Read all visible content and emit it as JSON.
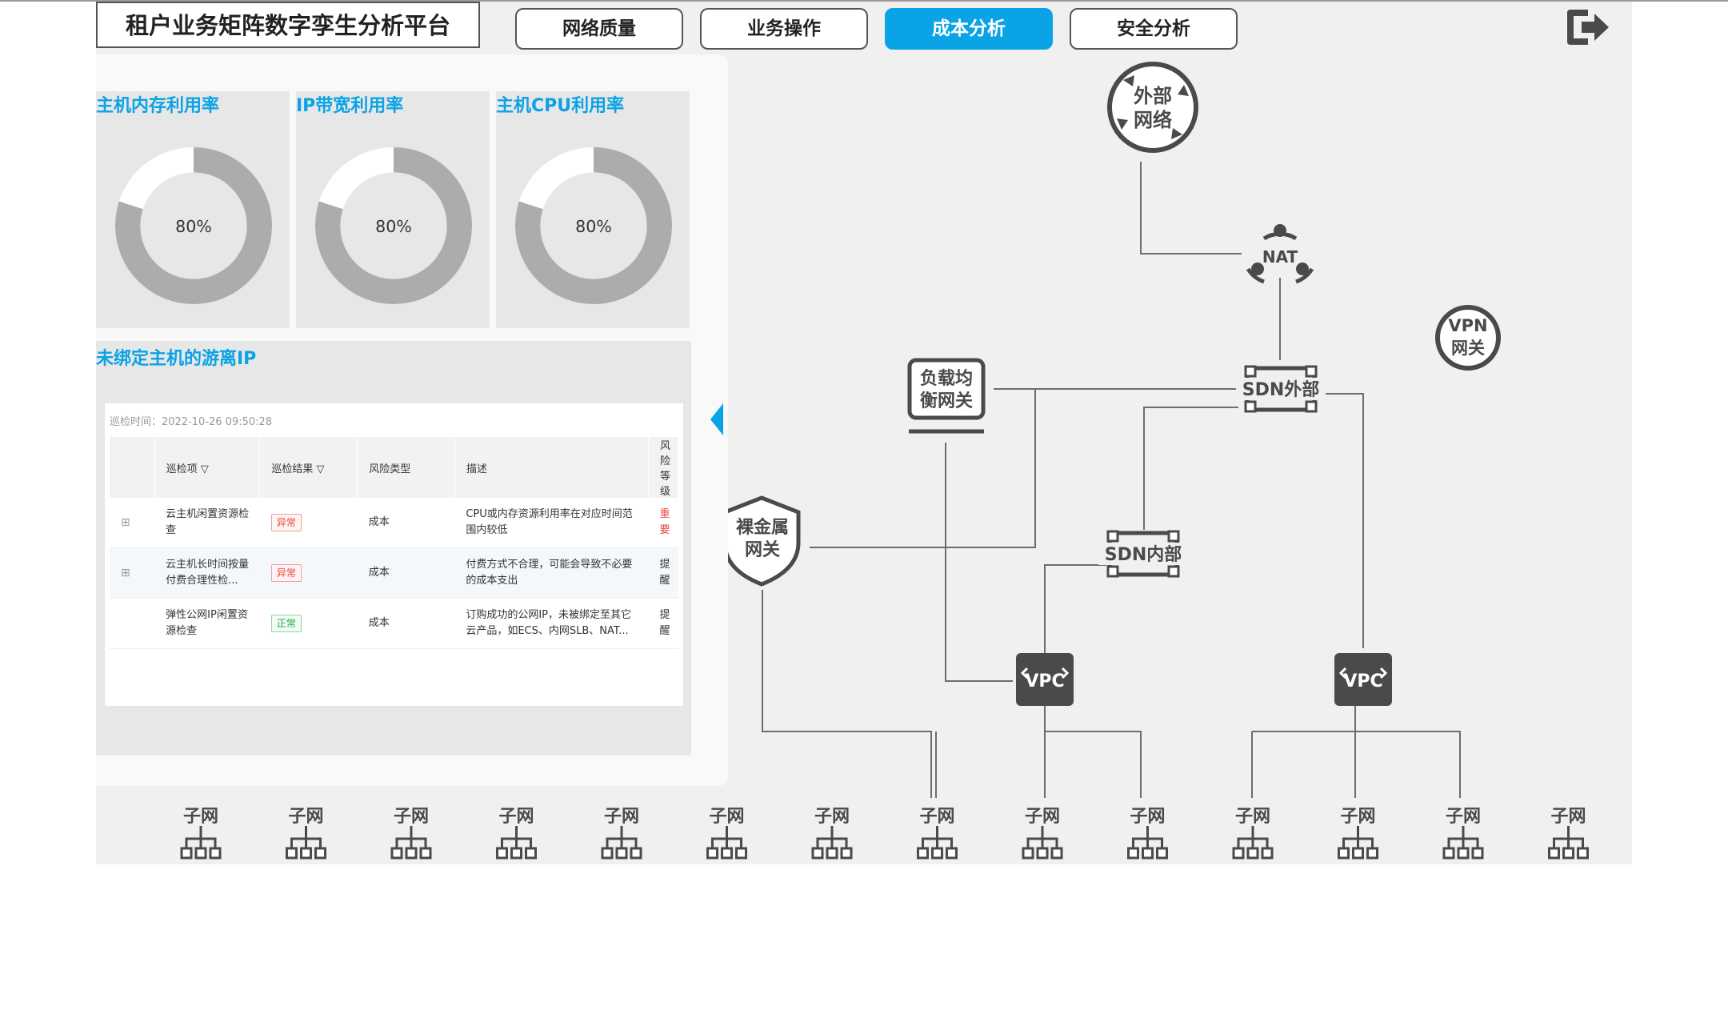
{
  "header": {
    "title": "租户业务矩阵数字孪生分析平台",
    "tabs": [
      {
        "label": "网络质量",
        "active": false
      },
      {
        "label": "业务操作",
        "active": false
      },
      {
        "label": "成本分析",
        "active": true
      },
      {
        "label": "安全分析",
        "active": false
      }
    ],
    "logout_icon": "logout-icon"
  },
  "colors": {
    "accent": "#0aa3e6",
    "error": "#e8453c",
    "ok": "#22a845",
    "node": "#4a4a4a"
  },
  "gauges": [
    {
      "title": "主机内存利用率",
      "value_label": "80%",
      "value": 0.8
    },
    {
      "title": "IP带宽利用率",
      "value_label": "80%",
      "value": 0.8
    },
    {
      "title": "主机CPU利用率",
      "value_label": "80%",
      "value": 0.8
    }
  ],
  "floating_ip": {
    "title": "未绑定主机的游离IP",
    "inspect_time": "巡检时间：2022-10-26 09:50:28",
    "columns": [
      "巡检项",
      "巡检结果",
      "风险类型",
      "描述",
      "风险等级"
    ],
    "rows": [
      {
        "item": "云主机闲置资源检查",
        "result": "异常",
        "result_type": "err",
        "risk_type": "成本",
        "desc": "CPU或内存资源利用率在对应时间范围内较低",
        "level": "重要",
        "level_red": true,
        "expandable": true
      },
      {
        "item": "云主机长时间按量付费合理性检...",
        "result": "异常",
        "result_type": "err",
        "risk_type": "成本",
        "desc": "付费方式不合理，可能会导致不必要的成本支出",
        "level": "提醒",
        "level_red": false,
        "expandable": true
      },
      {
        "item": "弹性公网IP闲置资源检查",
        "result": "正常",
        "result_type": "ok",
        "risk_type": "成本",
        "desc": "订购成功的公网IP，未被绑定至其它云产品，如ECS、内网SLB、NAT...",
        "level": "提醒",
        "level_red": false,
        "expandable": false
      }
    ]
  },
  "topology": {
    "external": [
      "外部",
      "网络"
    ],
    "nat": "NAT",
    "vpn": [
      "VPN",
      "网关"
    ],
    "sdn_ext": "SDN外部",
    "sdn_int": "SDN内部",
    "lb": [
      "负载均",
      "衡网关"
    ],
    "bare_metal": [
      "裸金属",
      "网关"
    ],
    "vpc1": "VPC",
    "vpc2": "VPC",
    "subnet_label": "子网",
    "subnet_count": 14
  }
}
